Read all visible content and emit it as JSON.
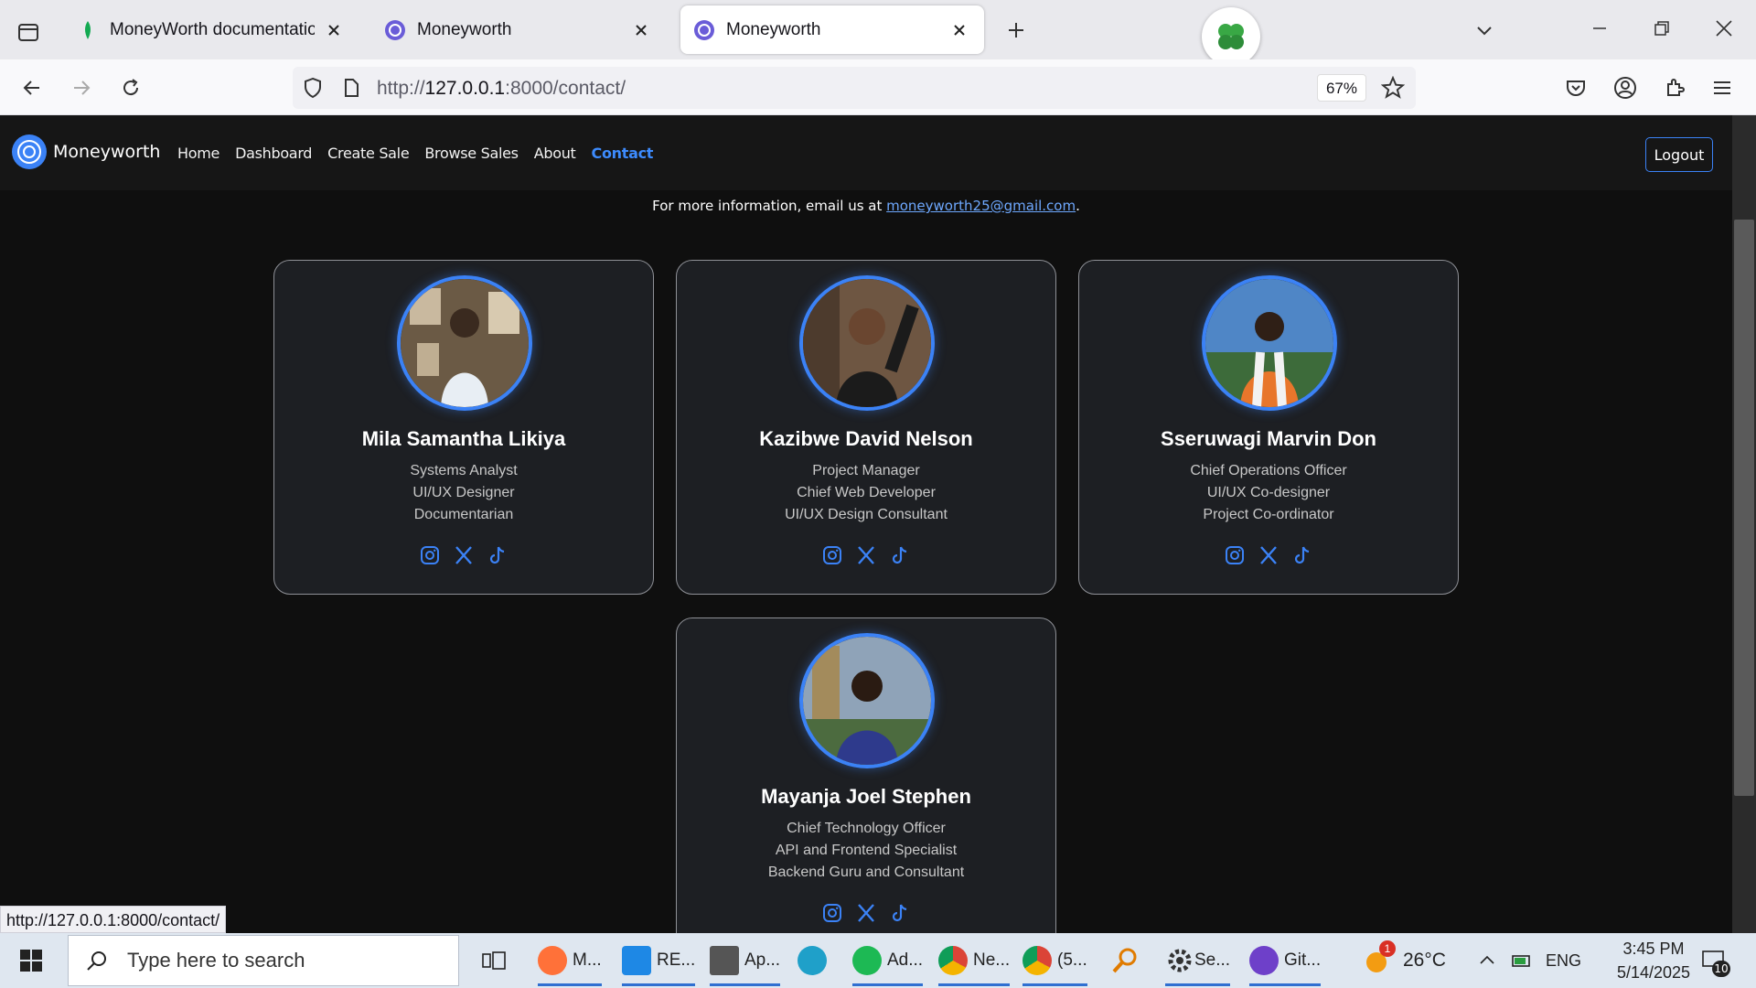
{
  "browser": {
    "tabs": [
      {
        "title": "MoneyWorth documentation - (",
        "active": false
      },
      {
        "title": "Moneyworth",
        "active": false
      },
      {
        "title": "Moneyworth",
        "active": true
      }
    ],
    "url_prefix": "http://",
    "url_host": "127.0.0.1",
    "url_rest": ":8000/contact/",
    "zoom": "67%",
    "status_url": "http://127.0.0.1:8000/contact/"
  },
  "site": {
    "brand": "Moneyworth",
    "nav": [
      "Home",
      "Dashboard",
      "Create Sale",
      "Browse Sales",
      "About",
      "Contact"
    ],
    "active_nav": "Contact",
    "logout_label": "Logout",
    "info_prefix": "For more information, email us at ",
    "info_email": "moneyworth25@gmail.com",
    "info_suffix": "."
  },
  "team": [
    {
      "name": "Mila Samantha Likiya",
      "roles": [
        "Systems Analyst",
        "UI/UX Designer",
        "Documentarian"
      ]
    },
    {
      "name": "Kazibwe David Nelson",
      "roles": [
        "Project Manager",
        "Chief Web Developer",
        "UI/UX Design Consultant"
      ]
    },
    {
      "name": "Sseruwagi Marvin Don",
      "roles": [
        "Chief Operations Officer",
        "UI/UX Co-designer",
        "Project Co-ordinator"
      ]
    },
    {
      "name": "Mayanja Joel Stephen",
      "roles": [
        "Chief Technology Officer",
        "API and Frontend Specialist",
        "Backend Guru and Consultant"
      ]
    }
  ],
  "taskbar": {
    "search_placeholder": "Type here to search",
    "apps": [
      {
        "label": "M...",
        "icon": "firefox-icon"
      },
      {
        "label": "RE...",
        "icon": "vscode-icon"
      },
      {
        "label": "Ap...",
        "icon": "app-icon"
      },
      {
        "label": "",
        "icon": "edge-icon"
      },
      {
        "label": "Ad...",
        "icon": "spotify-icon"
      },
      {
        "label": "Ne...",
        "icon": "chrome-icon"
      },
      {
        "label": "(5...",
        "icon": "chrome-icon"
      },
      {
        "label": "",
        "icon": "magnifier-icon"
      },
      {
        "label": "Se...",
        "icon": "settings-icon"
      },
      {
        "label": "Git...",
        "icon": "github-icon"
      }
    ],
    "weather_badge": "1",
    "temperature": "26°C",
    "language": "ENG",
    "time": "3:45 PM",
    "date": "5/14/2025",
    "notifications": "10"
  },
  "colors": {
    "accent": "#3b82f6",
    "nav_active": "#3d8bfd",
    "card_bg": "#1d1f23"
  }
}
